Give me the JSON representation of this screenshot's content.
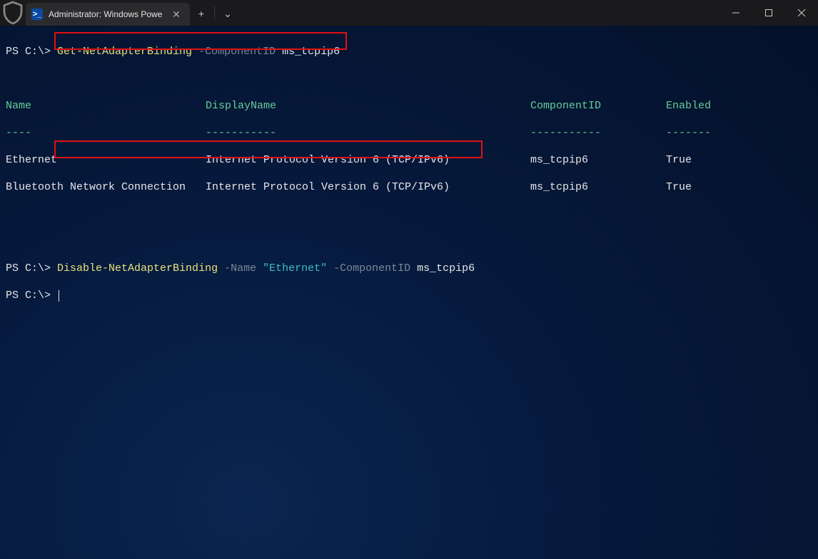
{
  "titlebar": {
    "tab_title": "Administrator: Windows Powe",
    "tab_close": "✕",
    "new_tab": "+",
    "dropdown": "⌄"
  },
  "prompt": "PS C:\\>",
  "cmd1": {
    "cmd": "Get-NetAdapterBinding ",
    "param": "-ComponentID ",
    "val": "ms_tcpip6"
  },
  "headers": {
    "name": "Name",
    "display": "DisplayName",
    "component": "ComponentID",
    "enabled": "Enabled"
  },
  "underlines": {
    "name": "----",
    "display": "-----------",
    "component": "-----------",
    "enabled": "-------"
  },
  "rows": [
    {
      "name": "Ethernet",
      "display": "Internet Protocol Version 6 (TCP/IPv6)",
      "component": "ms_tcpip6",
      "enabled": "True"
    },
    {
      "name": "Bluetooth Network Connection",
      "display": "Internet Protocol Version 6 (TCP/IPv6)",
      "component": "ms_tcpip6",
      "enabled": "True"
    }
  ],
  "cmd2": {
    "cmd": "Disable-NetAdapterBinding ",
    "param1": "-Name ",
    "val1": "\"Ethernet\" ",
    "param2": "-ComponentID ",
    "val2": "ms_tcpip6"
  }
}
